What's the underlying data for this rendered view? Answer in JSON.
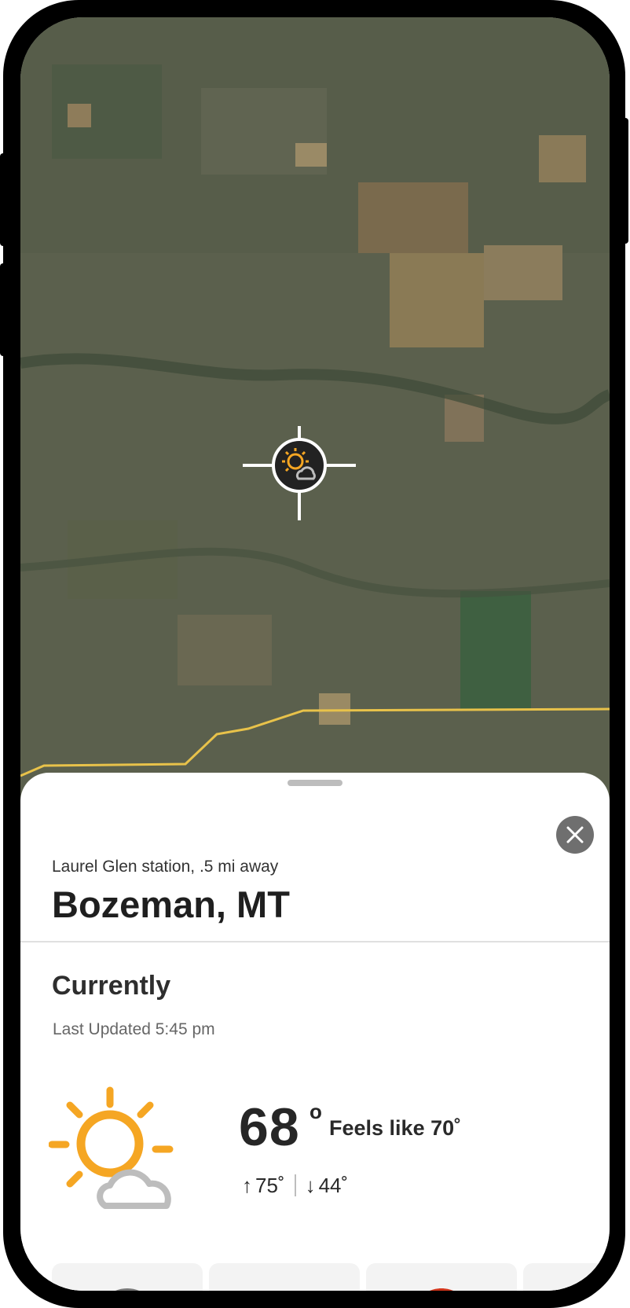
{
  "station": {
    "label": "Laurel Glen station, .5 mi away"
  },
  "location": {
    "city": "Bozeman, MT"
  },
  "currently": {
    "title": "Currently",
    "last_updated": "Last Updated 5:45 pm",
    "condition_icon": "partly-cloudy-icon",
    "temperature": "68",
    "degree_symbol": "o",
    "feels_like": "Feels like 70˚",
    "high": "75˚",
    "low": "44˚"
  },
  "map": {
    "marker_icon": "partly-cloudy-icon",
    "background": "satellite"
  },
  "cards": [
    {
      "icon": "clock-icon"
    },
    {
      "icon": "cloud-rain-icon"
    },
    {
      "icon": "gauge-icon"
    },
    {
      "icon": "card"
    }
  ],
  "colors": {
    "accent_sun": "#F5A623",
    "cloud": "#BDBDBD",
    "close_button": "#6F6F6F",
    "road": "#E8C24A"
  }
}
